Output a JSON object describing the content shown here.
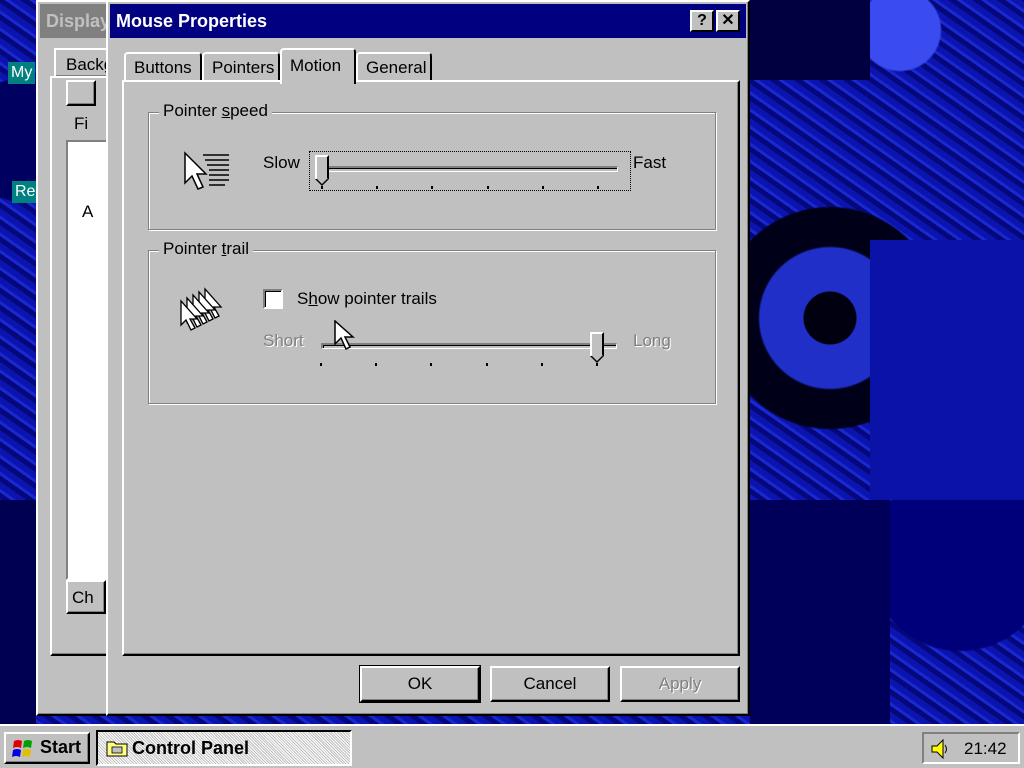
{
  "desktop": {
    "icons": [
      {
        "label": "My"
      },
      {
        "label": "Re"
      }
    ]
  },
  "background_window": {
    "title": "Display",
    "tab_label": "Backg",
    "menu_label": "Fi",
    "list_text": "A",
    "button_label": "Ch"
  },
  "dialog": {
    "title": "Mouse Properties",
    "help_button": "?",
    "close_button": "✕",
    "tabs": [
      {
        "label": "Buttons",
        "active": false
      },
      {
        "label": "Pointers",
        "active": false
      },
      {
        "label": "Motion",
        "active": true
      },
      {
        "label": "General",
        "active": false
      }
    ],
    "pointer_speed": {
      "legend_pre": "Pointer ",
      "legend_hotkey": "s",
      "legend_post": "peed",
      "min_label": "Slow",
      "max_label": "Fast",
      "value": 0,
      "max": 5
    },
    "pointer_trail": {
      "legend_pre": "Pointer ",
      "legend_hotkey": "t",
      "legend_post": "rail",
      "checkbox_pre": "S",
      "checkbox_hotkey": "h",
      "checkbox_post": "ow pointer trails",
      "checked": false,
      "min_label": "Short",
      "max_label": "Long",
      "value": 5,
      "max": 5,
      "enabled": false
    },
    "buttons": {
      "ok": "OK",
      "cancel": "Cancel",
      "apply": "Apply",
      "apply_enabled": false
    }
  },
  "taskbar": {
    "start_label": "Start",
    "tasks": [
      {
        "label": "Control Panel",
        "active": true
      }
    ],
    "clock": "21:42",
    "tray_icons": [
      "speaker-icon"
    ]
  }
}
